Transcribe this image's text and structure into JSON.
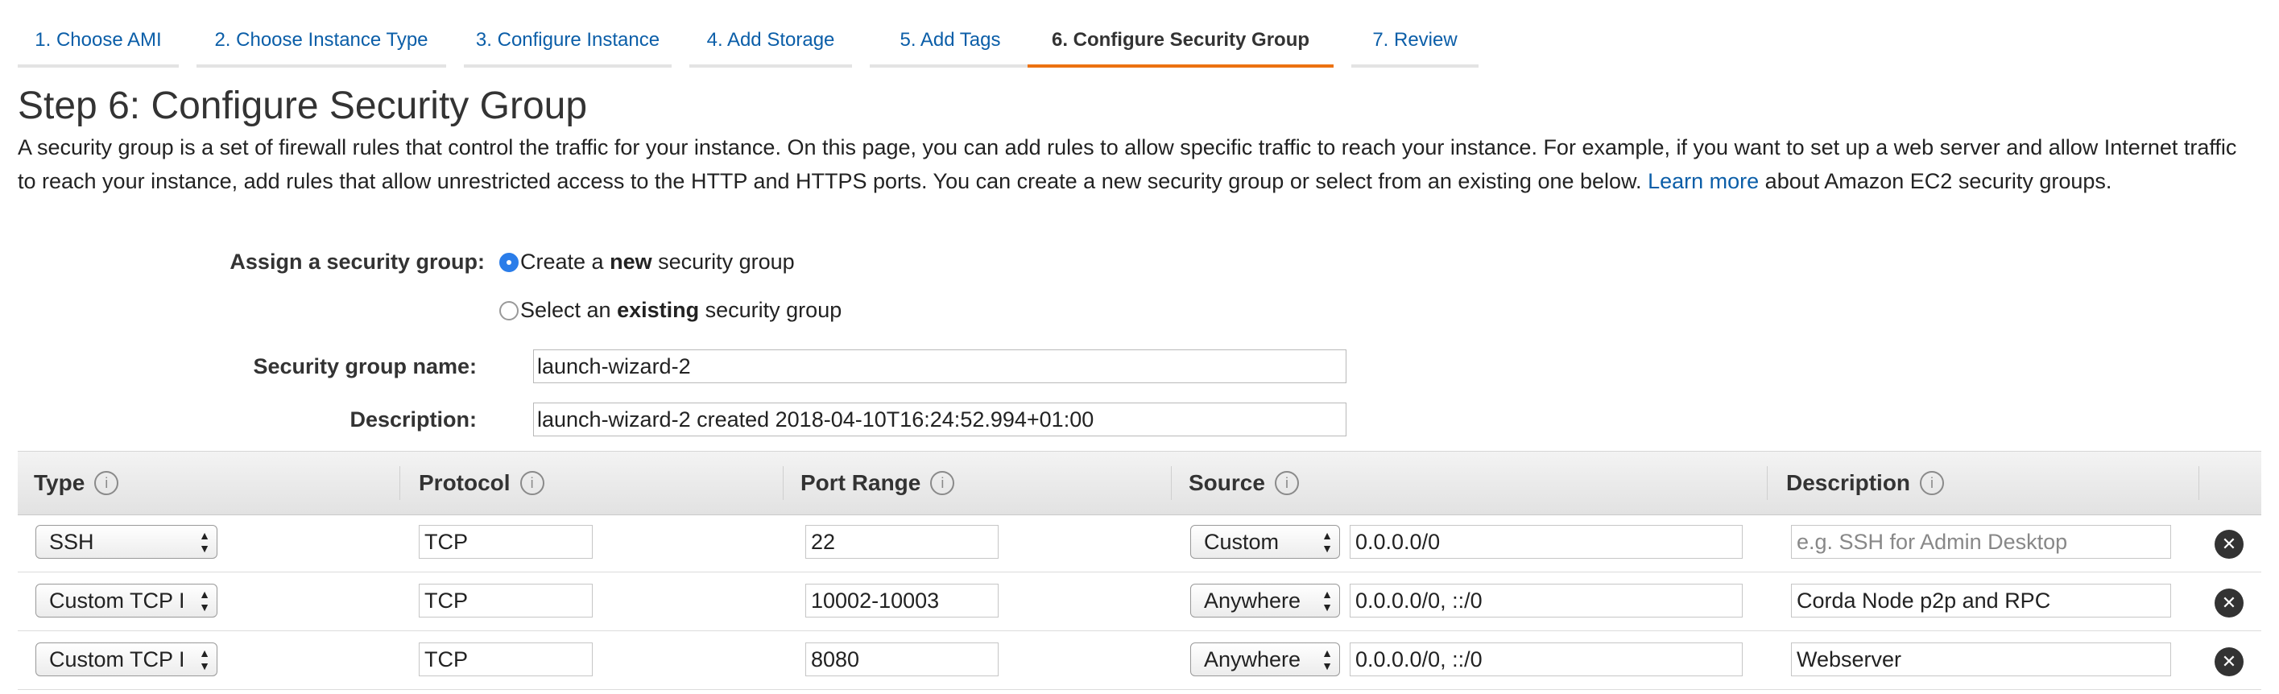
{
  "tabs": [
    {
      "label": "1. Choose AMI"
    },
    {
      "label": "2. Choose Instance Type"
    },
    {
      "label": "3. Configure Instance"
    },
    {
      "label": "4. Add Storage"
    },
    {
      "label": "5. Add Tags"
    },
    {
      "label": "6. Configure Security Group",
      "active": true
    },
    {
      "label": "7. Review"
    }
  ],
  "page": {
    "title": "Step 6: Configure Security Group",
    "intro_before_link": "A security group is a set of firewall rules that control the traffic for your instance. On this page, you can add rules to allow specific traffic to reach your instance. For example, if you want to set up a web server and allow Internet traffic to reach your instance, add rules that allow unrestricted access to the HTTP and HTTPS ports. You can create a new security group or select from an existing one below.",
    "learn_more": "Learn more",
    "intro_after_link": "about Amazon EC2 security groups."
  },
  "assign": {
    "label": "Assign a security group:",
    "option_new": {
      "prefix": "Create a ",
      "bold": "new",
      "suffix": " security group",
      "selected": true
    },
    "option_existing": {
      "prefix": "Select an ",
      "bold": "existing",
      "suffix": " security group",
      "selected": false
    }
  },
  "form": {
    "name_label": "Security group name:",
    "name_value": "launch-wizard-2",
    "description_label": "Description:",
    "description_value": "launch-wizard-2 created 2018-04-10T16:24:52.994+01:00"
  },
  "table": {
    "columns": [
      "Type",
      "Protocol",
      "Port Range",
      "Source",
      "Description"
    ],
    "info_glyph": "i",
    "rows": [
      {
        "type": "SSH",
        "protocol": "TCP",
        "port_range": "22",
        "source_mode": "Custom",
        "source_cidr": "0.0.0.0/0",
        "description": "",
        "description_placeholder": "e.g. SSH for Admin Desktop"
      },
      {
        "type": "Custom TCP I",
        "protocol": "TCP",
        "port_range": "10002-10003",
        "source_mode": "Anywhere",
        "source_cidr": "0.0.0.0/0, ::/0",
        "description": "Corda Node p2p and RPC",
        "description_placeholder": ""
      },
      {
        "type": "Custom TCP I",
        "protocol": "TCP",
        "port_range": "8080",
        "source_mode": "Anywhere",
        "source_cidr": "0.0.0.0/0, ::/0",
        "description": "Webserver",
        "description_placeholder": ""
      }
    ]
  },
  "icons": {
    "select_arrows": "up-down-arrows-icon",
    "remove": "close-circle-icon",
    "info": "info-icon"
  },
  "colors": {
    "link": "#0b5ea8",
    "active_tab_underline": "#ec7211",
    "radio_selected": "#2b7de9"
  }
}
